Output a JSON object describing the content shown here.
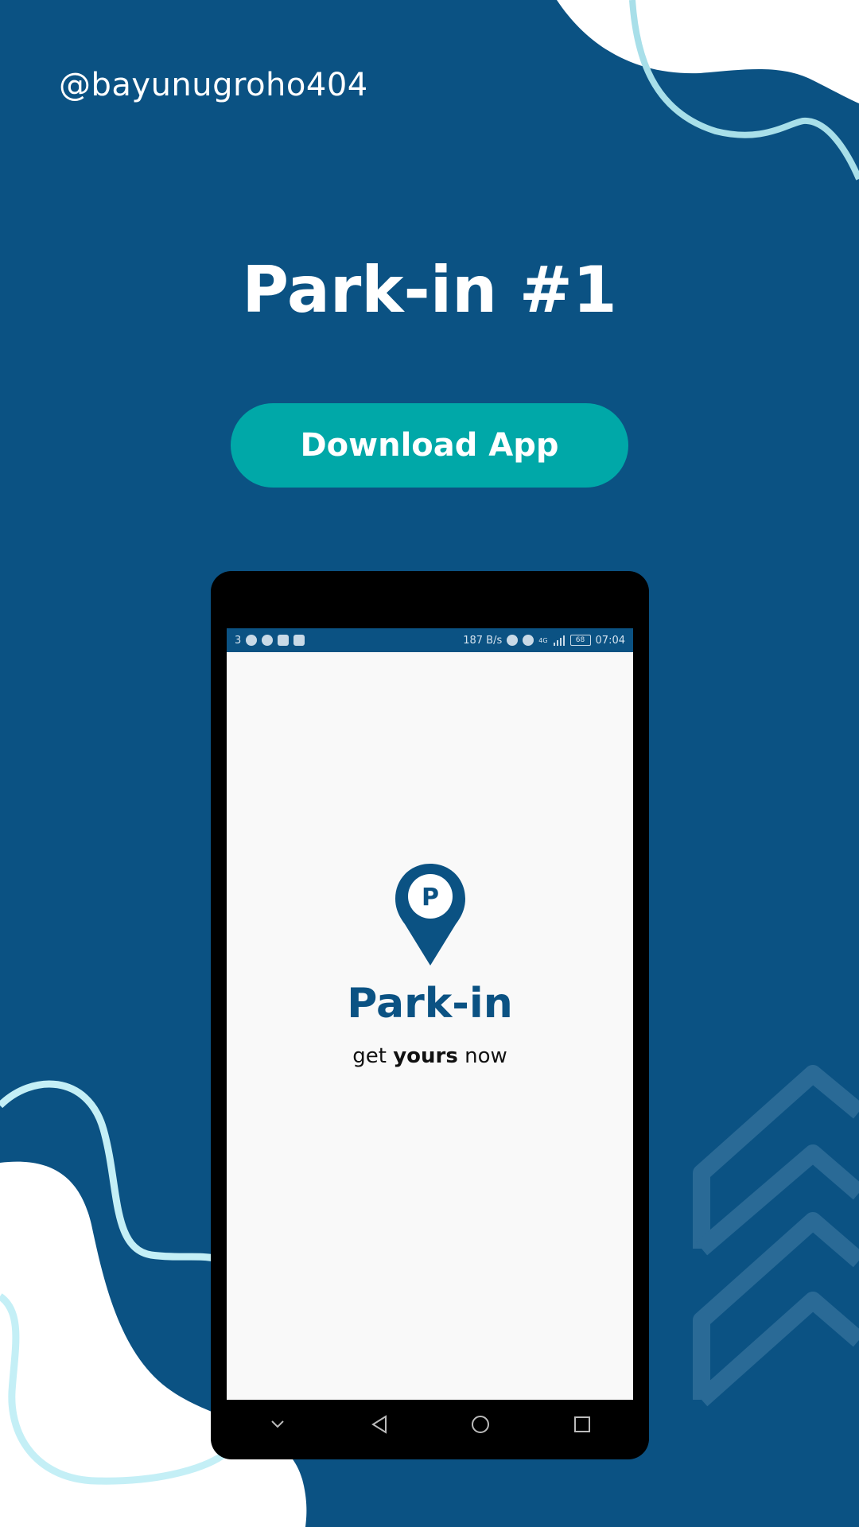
{
  "handle": "@bayunugroho404",
  "title": "Park-in #1",
  "download_button": "Download App",
  "colors": {
    "background": "#0b5283",
    "button": "#00a8a8",
    "accent_line": "#a8dfe9",
    "brand": "#0b5283"
  },
  "phone": {
    "status_bar": {
      "notification_count": "3",
      "left_icons": [
        "spotify-icon",
        "android-icon",
        "gmail-icon",
        "mail-icon"
      ],
      "network_speed": "187 B/s",
      "right_icons": [
        "hotspot-icon",
        "eye-icon",
        "signal-icon"
      ],
      "network_type": "4G",
      "battery": "68",
      "time": "07:04"
    },
    "app": {
      "logo_letter": "P",
      "name": "Park-in",
      "tagline_before": "get ",
      "tagline_bold": "yours",
      "tagline_after": " now"
    },
    "nav_icons": [
      "chevron-down-icon",
      "back-icon",
      "home-icon",
      "recents-icon"
    ]
  }
}
